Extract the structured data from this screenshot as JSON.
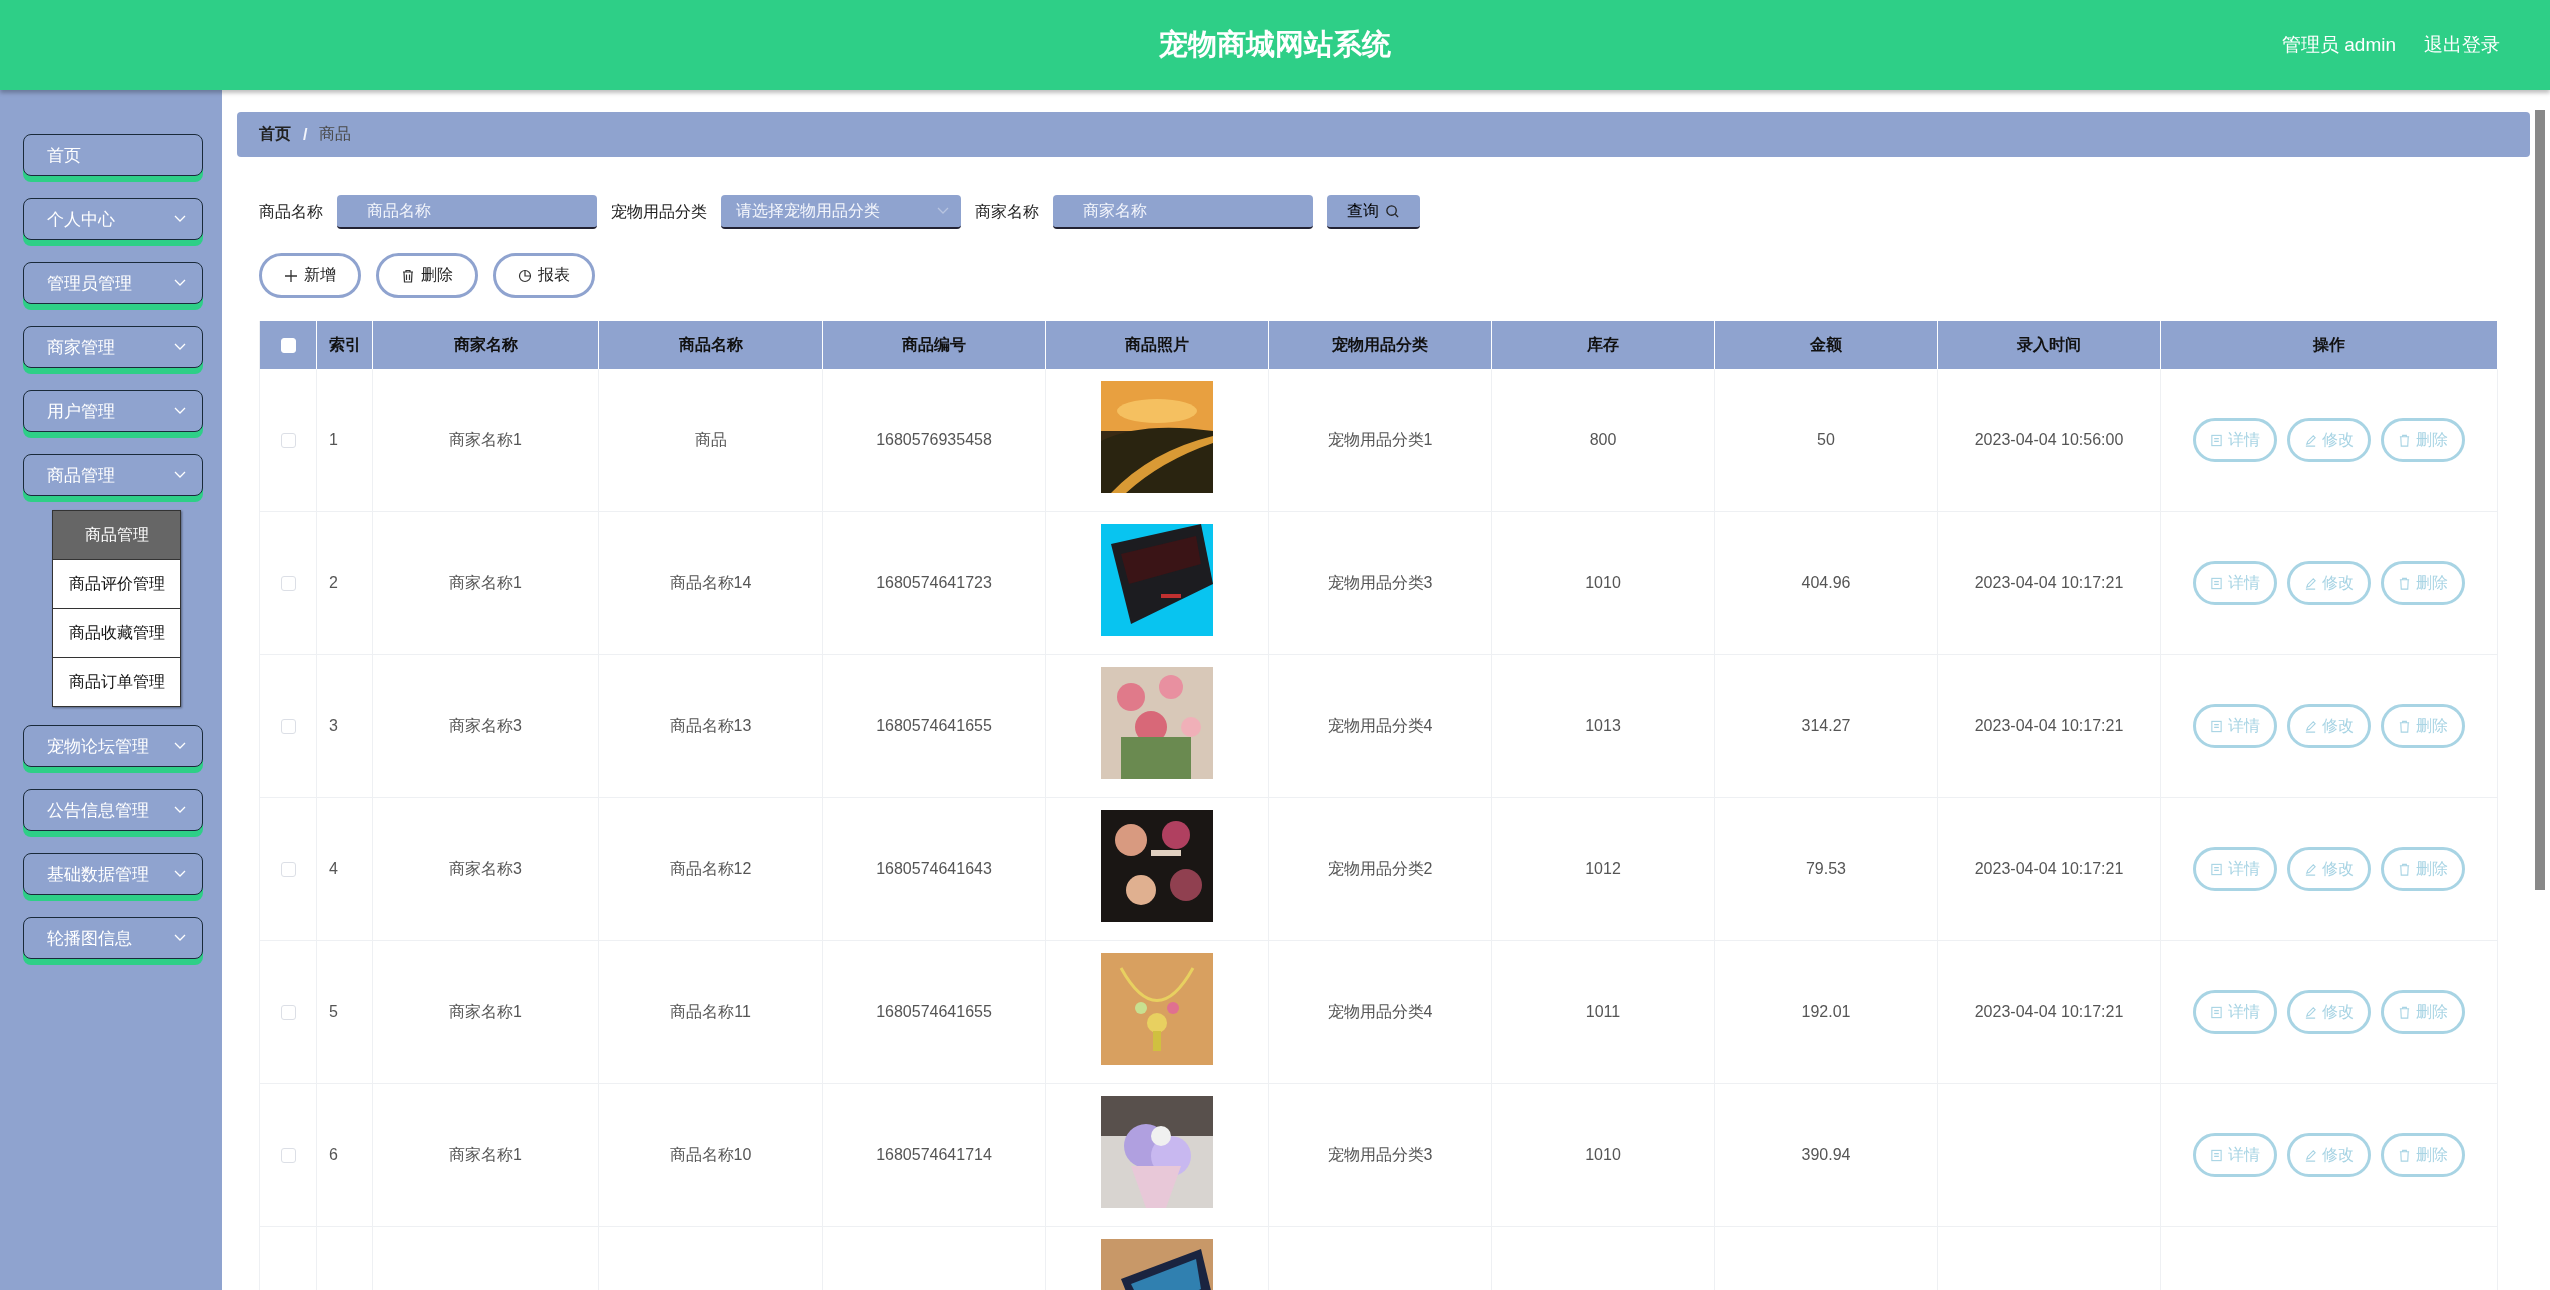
{
  "header": {
    "title": "宠物商城网站系统",
    "user": "管理员 admin",
    "logout": "退出登录"
  },
  "sidebar": {
    "items": [
      {
        "label": "首页",
        "kind": "link"
      },
      {
        "label": "个人中心",
        "kind": "menu"
      },
      {
        "label": "管理员管理",
        "kind": "menu"
      },
      {
        "label": "商家管理",
        "kind": "menu"
      },
      {
        "label": "用户管理",
        "kind": "menu"
      },
      {
        "label": "商品管理",
        "kind": "menu",
        "children": [
          {
            "label": "商品管理",
            "selected": true
          },
          {
            "label": "商品评价管理",
            "selected": false
          },
          {
            "label": "商品收藏管理",
            "selected": false
          },
          {
            "label": "商品订单管理",
            "selected": false
          }
        ]
      },
      {
        "label": "宠物论坛管理",
        "kind": "menu"
      },
      {
        "label": "公告信息管理",
        "kind": "menu"
      },
      {
        "label": "基础数据管理",
        "kind": "menu"
      },
      {
        "label": "轮播图信息",
        "kind": "menu"
      }
    ]
  },
  "breadcrumb": [
    "首页",
    "商品"
  ],
  "breadcrumb_separator": "/",
  "search": {
    "fields": [
      {
        "label": "商品名称",
        "placeholder": "商品名称",
        "kind": "input"
      },
      {
        "label": "宠物用品分类",
        "placeholder": "请选择宠物用品分类",
        "kind": "select"
      },
      {
        "label": "商家名称",
        "placeholder": "商家名称",
        "kind": "input"
      }
    ],
    "button": "查询"
  },
  "toolbar": [
    "新增",
    "删除",
    "报表"
  ],
  "table": {
    "header_checked": false,
    "columns": [
      "索引",
      "商家名称",
      "商品名称",
      "商品编号",
      "商品照片",
      "宠物用品分类",
      "库存",
      "金额",
      "录入时间",
      "操作"
    ],
    "rows": [
      {
        "checked": false,
        "index": "1",
        "merchant": "商家名称1",
        "name": "商品",
        "code": "1680576935458",
        "photo": {
          "kind": "picture"
        },
        "category": "宠物用品分类1",
        "stock": "800",
        "amount": "50",
        "time": "2023-04-04 10:56:00",
        "actions": [
          "详情",
          "修改",
          "删除"
        ]
      },
      {
        "checked": false,
        "index": "2",
        "merchant": "商家名称1",
        "name": "商品名称14",
        "code": "1680574641723",
        "photo": {
          "kind": "picture"
        },
        "category": "宠物用品分类3",
        "stock": "1010",
        "amount": "404.96",
        "time": "2023-04-04 10:17:21",
        "actions": [
          "详情",
          "修改",
          "删除"
        ]
      },
      {
        "checked": false,
        "index": "3",
        "merchant": "商家名称3",
        "name": "商品名称13",
        "code": "1680574641655",
        "photo": {
          "kind": "picture"
        },
        "category": "宠物用品分类4",
        "stock": "1013",
        "amount": "314.27",
        "time": "2023-04-04 10:17:21",
        "actions": [
          "详情",
          "修改",
          "删除"
        ]
      },
      {
        "checked": false,
        "index": "4",
        "merchant": "商家名称3",
        "name": "商品名称12",
        "code": "1680574641643",
        "photo": {
          "kind": "picture"
        },
        "category": "宠物用品分类2",
        "stock": "1012",
        "amount": "79.53",
        "time": "2023-04-04 10:17:21",
        "actions": [
          "详情",
          "修改",
          "删除"
        ]
      },
      {
        "checked": false,
        "index": "5",
        "merchant": "商家名称1",
        "name": "商品名称11",
        "code": "1680574641655",
        "photo": {
          "kind": "picture"
        },
        "category": "宠物用品分类4",
        "stock": "1011",
        "amount": "192.01",
        "time": "2023-04-04 10:17:21",
        "actions": [
          "详情",
          "修改",
          "删除"
        ]
      },
      {
        "checked": false,
        "index": "6",
        "merchant": "商家名称1",
        "name": "商品名称10",
        "code": "1680574641714",
        "photo": {
          "kind": "picture"
        },
        "category": "宠物用品分类3",
        "stock": "1010",
        "amount": "390.94",
        "actions": [
          "详情",
          "修改",
          "删除"
        ]
      },
      {
        "photo": {
          "kind": "picture"
        }
      }
    ]
  }
}
